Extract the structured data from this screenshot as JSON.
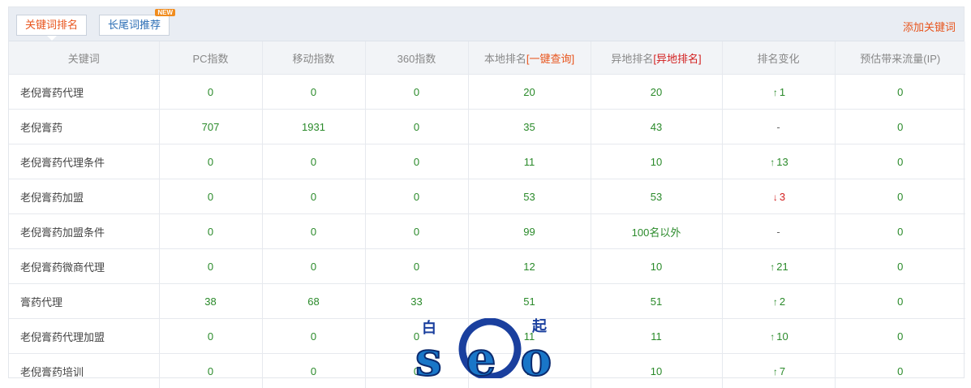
{
  "tabs": [
    {
      "label": "关键词排名",
      "active": true
    },
    {
      "label": "长尾词推荐",
      "badge": "NEW",
      "active": false
    }
  ],
  "add_keyword_label": "添加关键词",
  "headers": {
    "keyword": "关键词",
    "pc": "PC指数",
    "mobile": "移动指数",
    "idx360": "360指数",
    "local_prefix": "本地排名",
    "local_link": "[一键查询]",
    "remote_prefix": "异地排名",
    "remote_link": "[异地排名]",
    "change": "排名变化",
    "traffic": "预估带来流量(IP)"
  },
  "rows": [
    {
      "keyword": "老倪膏药代理",
      "pc": "0",
      "mobile": "0",
      "idx360": "0",
      "local": "20",
      "remote": "20",
      "change_dir": "up",
      "change": "1",
      "traffic": "0"
    },
    {
      "keyword": "老倪膏药",
      "pc": "707",
      "mobile": "1931",
      "idx360": "0",
      "local": "35",
      "remote": "43",
      "change_dir": "flat",
      "change": "-",
      "traffic": "0"
    },
    {
      "keyword": "老倪膏药代理条件",
      "pc": "0",
      "mobile": "0",
      "idx360": "0",
      "local": "11",
      "remote": "10",
      "change_dir": "up",
      "change": "13",
      "traffic": "0"
    },
    {
      "keyword": "老倪膏药加盟",
      "pc": "0",
      "mobile": "0",
      "idx360": "0",
      "local": "53",
      "remote": "53",
      "change_dir": "down",
      "change": "3",
      "traffic": "0"
    },
    {
      "keyword": "老倪膏药加盟条件",
      "pc": "0",
      "mobile": "0",
      "idx360": "0",
      "local": "99",
      "remote": "100名以外",
      "change_dir": "flat",
      "change": "-",
      "traffic": "0"
    },
    {
      "keyword": "老倪膏药微商代理",
      "pc": "0",
      "mobile": "0",
      "idx360": "0",
      "local": "12",
      "remote": "10",
      "change_dir": "up",
      "change": "21",
      "traffic": "0"
    },
    {
      "keyword": "膏药代理",
      "pc": "38",
      "mobile": "68",
      "idx360": "33",
      "local": "51",
      "remote": "51",
      "change_dir": "up",
      "change": "2",
      "traffic": "0"
    },
    {
      "keyword": "老倪膏药代理加盟",
      "pc": "0",
      "mobile": "0",
      "idx360": "0",
      "local": "11",
      "remote": "11",
      "change_dir": "up",
      "change": "10",
      "traffic": "0"
    },
    {
      "keyword": "老倪膏药培训",
      "pc": "0",
      "mobile": "0",
      "idx360": "0",
      "local": "1",
      "remote": "10",
      "change_dir": "up",
      "change": "7",
      "traffic": "0"
    }
  ],
  "watermark": {
    "top_left": "白",
    "top_right": "起",
    "letters": "seo"
  },
  "colors": {
    "accent": "#e8541c",
    "green": "#2a8a2a",
    "red": "#d21e1e",
    "link_blue": "#2c6eb5",
    "watermark_blue": "#1a3f9e"
  }
}
